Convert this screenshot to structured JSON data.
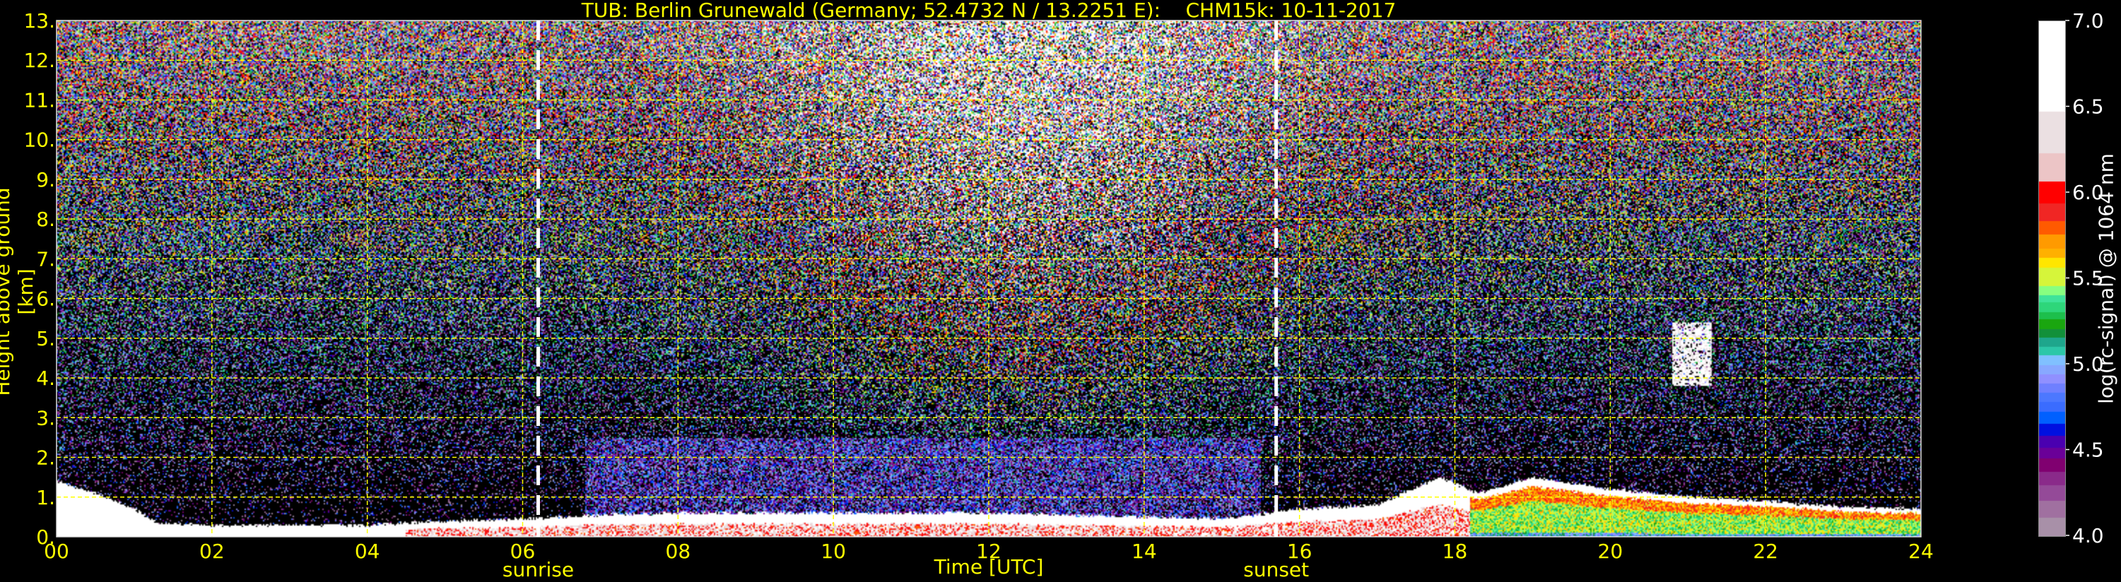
{
  "chart_data": {
    "type": "heatmap",
    "title": "TUB: Berlin Grunewald (Germany; 52.4732 N / 13.2251 E):    CHM15k: 10-11-2017",
    "xlabel": "Time [UTC]",
    "ylabel": "Height above ground [km]",
    "xlim": [
      0,
      24
    ],
    "ylim": [
      0,
      13
    ],
    "x_ticks": [
      "00",
      "02",
      "04",
      "06",
      "08",
      "10",
      "12",
      "14",
      "16",
      "18",
      "20",
      "22",
      "24"
    ],
    "y_ticks": [
      "0.",
      "1.",
      "2.",
      "3.",
      "4.",
      "5.",
      "6.",
      "7.",
      "8.",
      "9.",
      "10.",
      "11.",
      "12.",
      "13."
    ],
    "grid": true,
    "grid_color": "#ffff00",
    "annotations": [
      {
        "label": "sunrise",
        "x": 6.2
      },
      {
        "label": "sunset",
        "x": 15.7
      }
    ],
    "boundary_layer_top_km": {
      "x": [
        0,
        0.5,
        1.0,
        1.3,
        2,
        4,
        5,
        6,
        7,
        8,
        10,
        12,
        14,
        15,
        16,
        17,
        17.8,
        18.3,
        19,
        20,
        21,
        22,
        23,
        24
      ],
      "y": [
        1.4,
        1.1,
        0.7,
        0.35,
        0.3,
        0.3,
        0.4,
        0.45,
        0.55,
        0.6,
        0.6,
        0.6,
        0.5,
        0.45,
        0.7,
        0.8,
        1.5,
        1.1,
        1.5,
        1.2,
        1.0,
        0.9,
        0.75,
        0.7
      ]
    },
    "cloud": {
      "x": [
        20.8,
        21.3
      ],
      "y": [
        3.8,
        5.4
      ]
    },
    "colorbar": {
      "label": "log(rc-signal) @ 1064 nm",
      "range": [
        4.0,
        7.0
      ],
      "ticks": [
        "4.0",
        "4.5",
        "5.0",
        "5.5",
        "6.0",
        "6.5",
        "7.0"
      ],
      "boundaries": [
        4.0,
        4.11,
        4.21,
        4.3,
        4.38,
        4.455,
        4.52,
        4.59,
        4.66,
        4.73,
        4.785,
        4.84,
        4.895,
        4.95,
        5.0,
        5.06,
        5.11,
        5.16,
        5.21,
        5.265,
        5.31,
        5.365,
        5.41,
        5.46,
        5.57,
        5.625,
        5.68,
        5.76,
        5.84,
        5.94,
        6.07,
        6.235,
        6.48,
        7.0
      ],
      "colors": [
        "#a890a8",
        "#a070a0",
        "#944a98",
        "#8a2a8a",
        "#800070",
        "#6a0098",
        "#4a00b0",
        "#0010e0",
        "#0060ff",
        "#3a6cff",
        "#4c78ff",
        "#6f80ff",
        "#9090ff",
        "#88a8ff",
        "#80c0ff",
        "#2cc7a8",
        "#1ea68c",
        "#12903a",
        "#1aa60f",
        "#1dbf4c",
        "#2ed67a",
        "#3fe39a",
        "#88ff80",
        "#d6f53a",
        "#ffe600",
        "#ffb000",
        "#ff9a00",
        "#ff5a00",
        "#f02624",
        "#ff0000",
        "#ecc5c6",
        "#ebe0e2",
        "#ffffff"
      ]
    }
  }
}
